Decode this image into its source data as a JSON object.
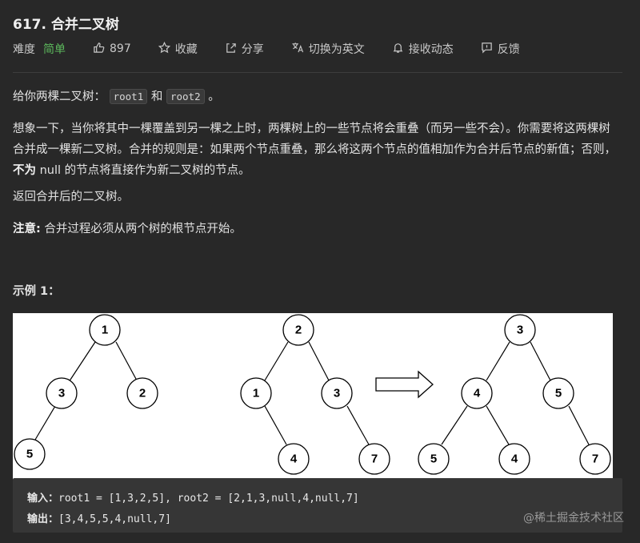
{
  "problem": {
    "title": "617. 合并二叉树"
  },
  "toolbar": {
    "difficulty_label": "难度",
    "difficulty_value": "简单",
    "likes": "897",
    "favorite": "收藏",
    "share": "分享",
    "switch_lang": "切换为英文",
    "notify": "接收动态",
    "feedback": "反馈",
    "icons": {
      "likes": "thumbs-up-icon",
      "favorite": "star-icon",
      "share": "share-icon",
      "switch_lang": "translate-icon",
      "notify": "bell-icon",
      "feedback": "feedback-icon"
    },
    "difficulty_color": "#5cb85c"
  },
  "description": {
    "p1_text": "给你两棵二叉树：",
    "p1_code1": "root1",
    "p1_and": "和",
    "p1_code2": "root2",
    "p1_end": "。",
    "p2_part1": "想象一下，当你将其中一棵覆盖到另一棵之上时，两棵树上的一些节点将会重叠（而另一些不会）。你需要将这两棵树合并成一棵新二叉树。合并的规则是：如果两个节点重叠，那么将这两个节点的值相加作为合并后节点的新值；否则，",
    "p2_bold": "不为",
    "p2_part2": " null 的节点将直接作为新二叉树的节点。",
    "p3": "返回合并后的二叉树。",
    "p4_bold": "注意:",
    "p4_text": " 合并过程必须从两个树的根节点开始。",
    "example_title": "示例 1："
  },
  "figure": {
    "tree1": [
      "1",
      "3",
      "2",
      "5"
    ],
    "tree2": [
      "2",
      "1",
      "3",
      "4",
      "7"
    ],
    "merged": [
      "3",
      "4",
      "5",
      "5",
      "4",
      "7"
    ]
  },
  "example": {
    "input_label": "输入：",
    "input_value": "root1 = [1,3,2,5], root2 = [2,1,3,null,4,null,7]",
    "output_label": "输出：",
    "output_value": "[3,4,5,5,4,null,7]"
  },
  "watermark": "@稀土掘金技术社区"
}
